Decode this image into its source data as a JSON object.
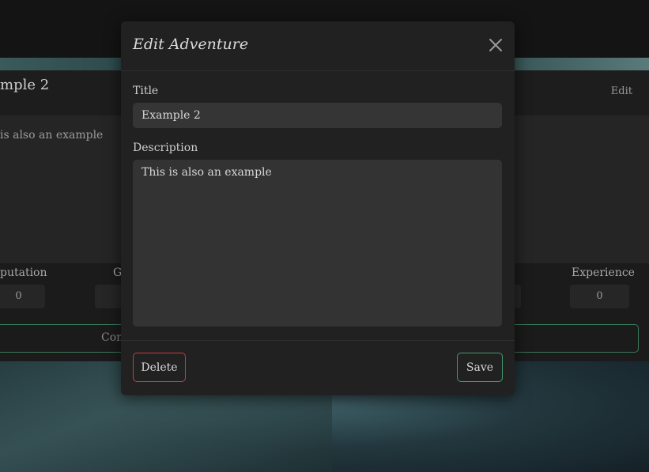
{
  "background": {
    "card_title": "mple 2",
    "card_edit_label": "Edit",
    "card_description": "is also an example",
    "stats": [
      {
        "label": "putation",
        "value": "0"
      },
      {
        "label": "G",
        "value": ""
      },
      {
        "label": "Experience",
        "value": "0"
      }
    ],
    "continue_label": "Con"
  },
  "modal": {
    "title": "Edit Adventure",
    "title_label": "Title",
    "title_value": "Example 2",
    "description_label": "Description",
    "description_value": "This is also an example",
    "delete_label": "Delete",
    "save_label": "Save"
  },
  "colors": {
    "delete_border": "#c0403f",
    "save_border": "#3f9b6e"
  },
  "icons": {
    "close": "close-icon"
  }
}
